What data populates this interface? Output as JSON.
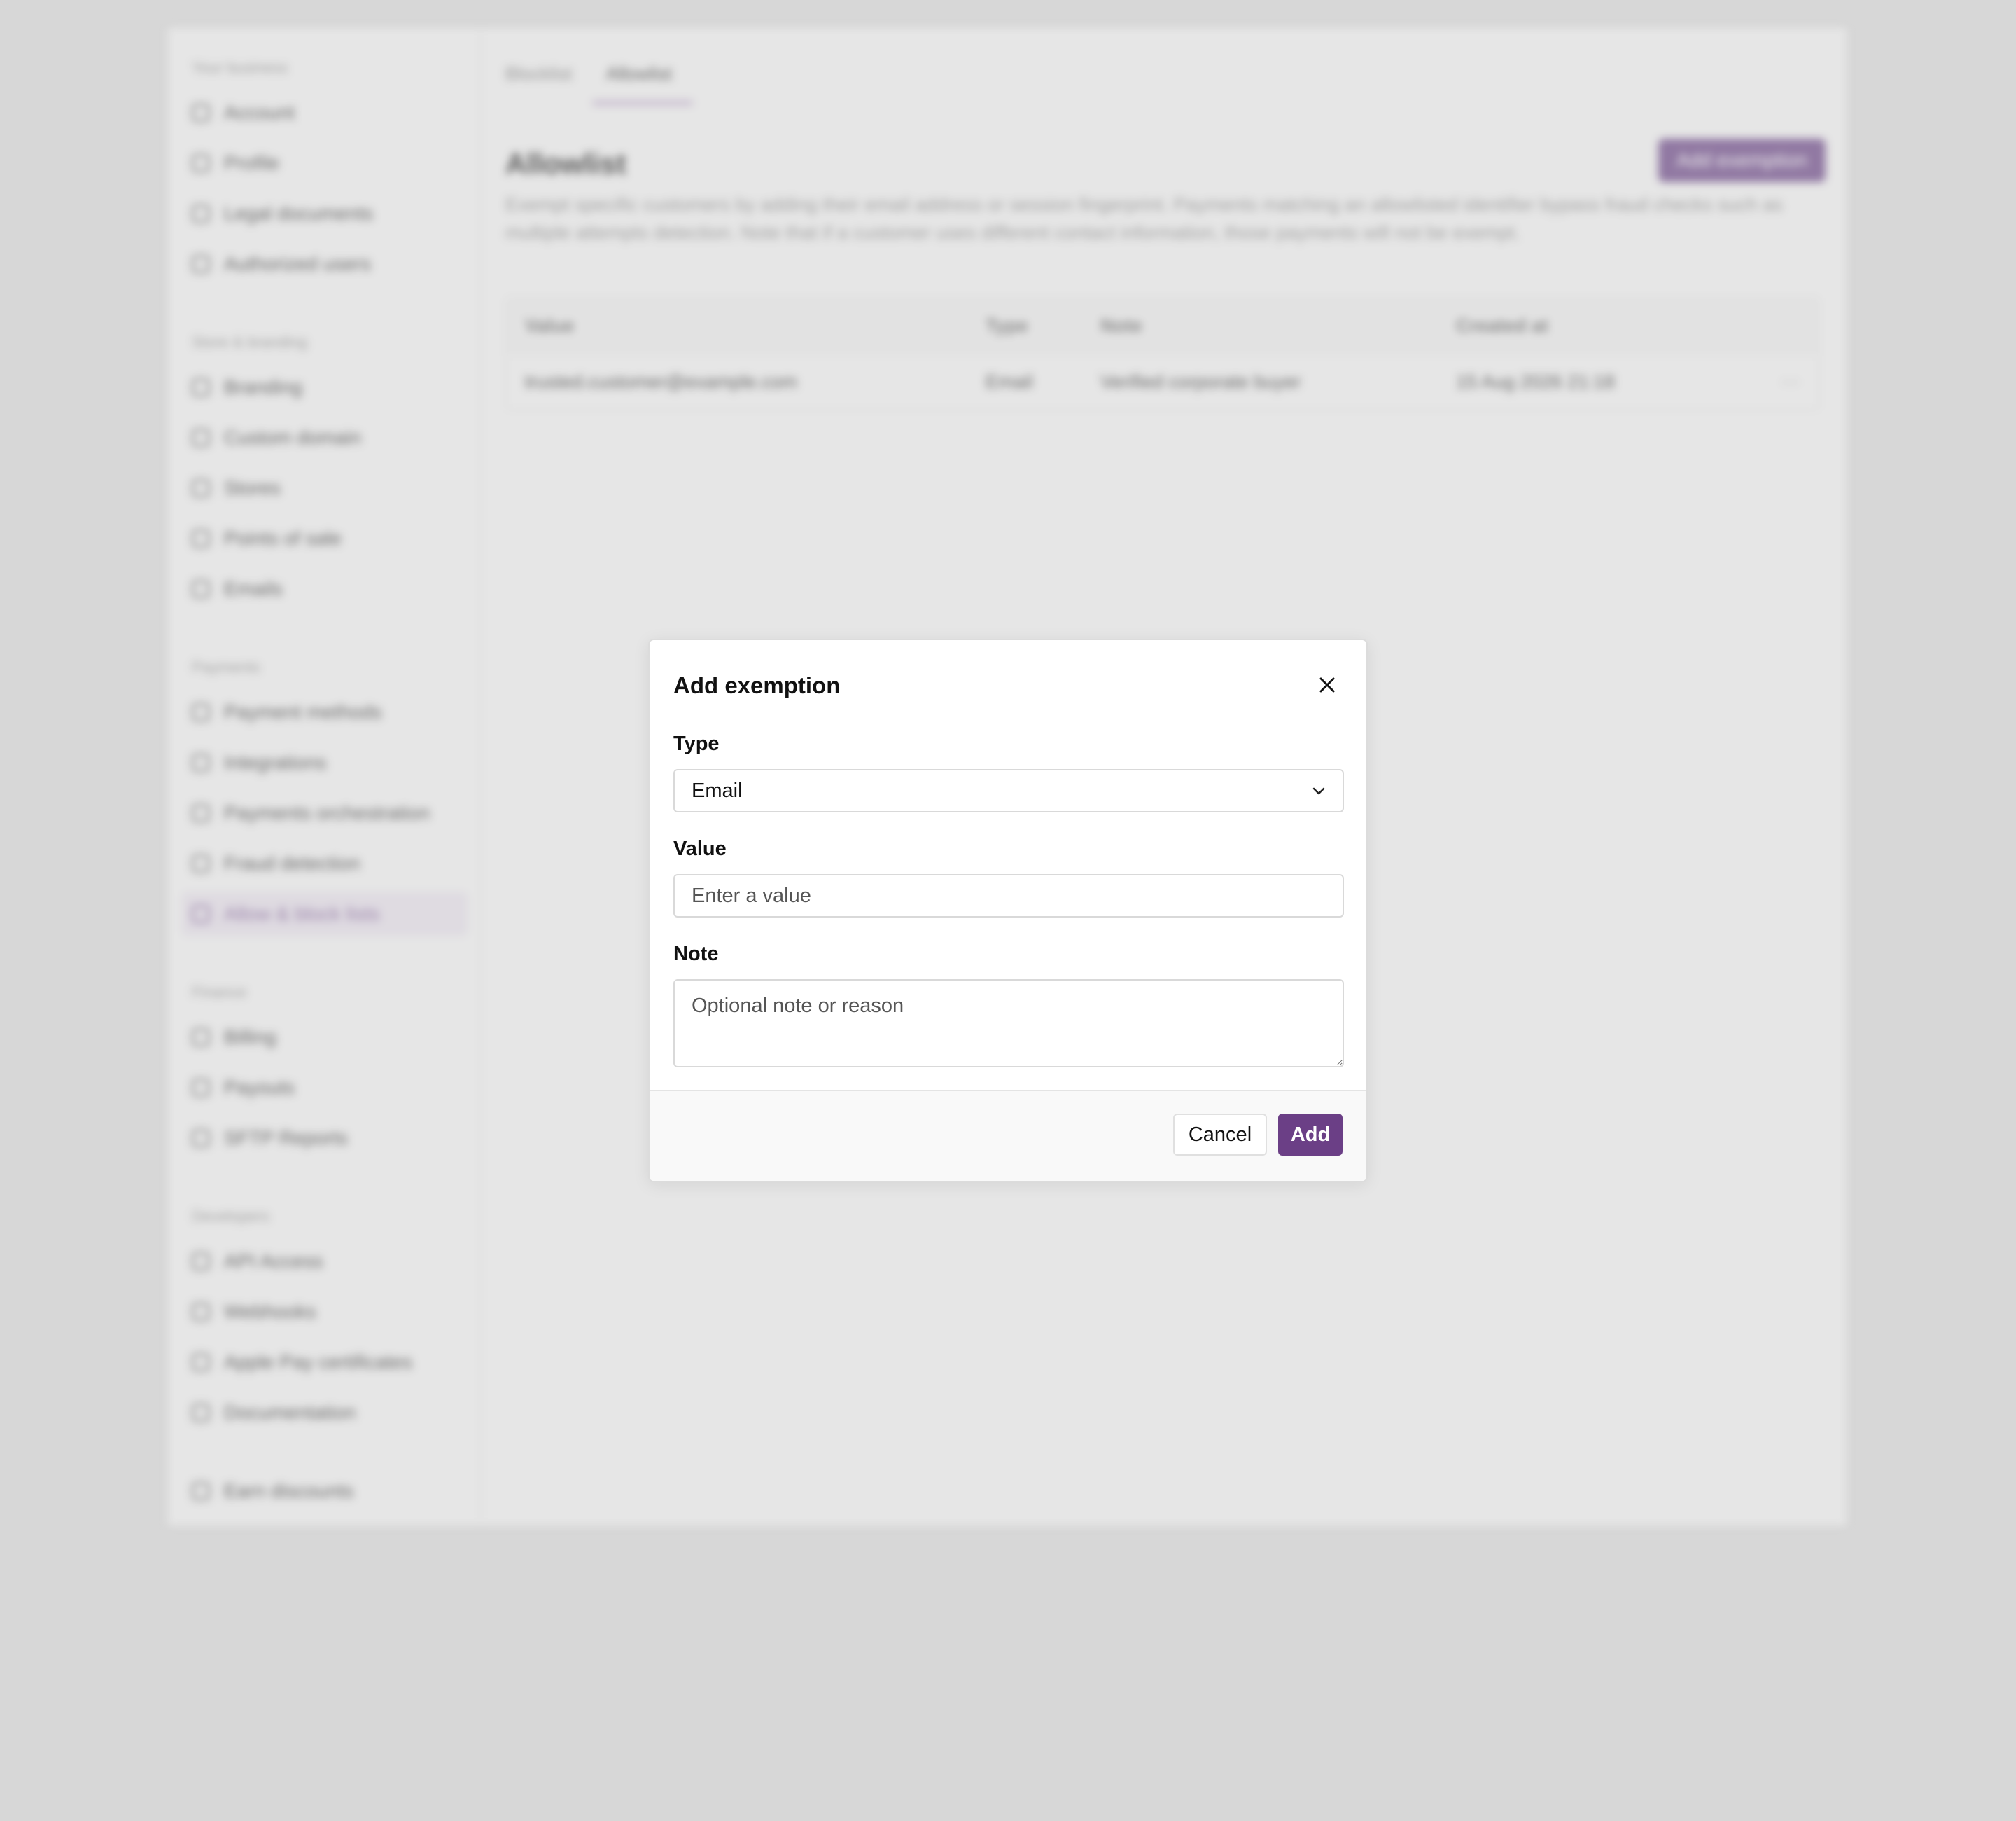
{
  "sidebar": {
    "sections": [
      {
        "label": "Your business",
        "items": [
          "Account",
          "Profile",
          "Legal documents",
          "Authorized users"
        ]
      },
      {
        "label": "Store & branding",
        "items": [
          "Branding",
          "Custom domain",
          "Stores",
          "Points of sale",
          "Emails"
        ]
      },
      {
        "label": "Payments",
        "items": [
          "Payment methods",
          "Integrations",
          "Payments orchestration",
          "Fraud detection",
          "Allow & block lists"
        ]
      },
      {
        "label": "Finance",
        "items": [
          "Billing",
          "Payouts",
          "SFTP Reports"
        ]
      },
      {
        "label": "Developers",
        "items": [
          "API Access",
          "Webhooks",
          "Apple Pay certificates",
          "Documentation"
        ]
      }
    ],
    "footer_item": "Earn discounts",
    "active_item": "Allow & block lists"
  },
  "main": {
    "tabs": [
      "Blocklist",
      "Allowlist"
    ],
    "active_tab": "Allowlist",
    "title": "Allowlist",
    "add_button": "Add exemption",
    "description": "Exempt specific customers by adding their email address or session fingerprint. Payments matching an allowlisted identifier bypass fraud checks such as multiple attempts detection. Note that if a customer uses different contact information, those payments will not be exempt.",
    "table": {
      "columns": [
        "Value",
        "Type",
        "Note",
        "Created at"
      ],
      "rows": [
        {
          "value": "trusted.customer@example.com",
          "type": "Email",
          "note": "Verified corporate buyer",
          "created_at": "15 Aug 2026 21:18",
          "menu": "⋯"
        }
      ]
    }
  },
  "modal": {
    "title": "Add exemption",
    "type_label": "Type",
    "type_value": "Email",
    "value_label": "Value",
    "value_placeholder": "Enter a value",
    "note_label": "Note",
    "note_placeholder": "Optional note or reason",
    "cancel_label": "Cancel",
    "add_label": "Add"
  },
  "colors": {
    "accent": "#6b3f86",
    "overlay": "#dadada"
  },
  "icons": {
    "close": "close-icon",
    "select": "chevron-down-icon"
  }
}
